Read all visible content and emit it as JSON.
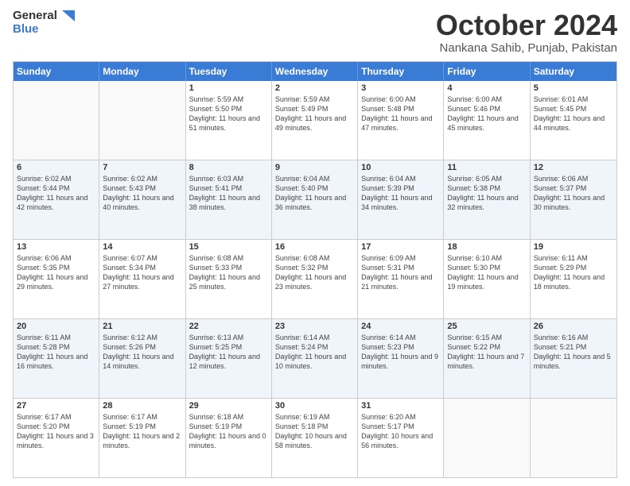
{
  "header": {
    "logo_general": "General",
    "logo_blue": "Blue",
    "month_title": "October 2024",
    "location": "Nankana Sahib, Punjab, Pakistan"
  },
  "calendar": {
    "days_of_week": [
      "Sunday",
      "Monday",
      "Tuesday",
      "Wednesday",
      "Thursday",
      "Friday",
      "Saturday"
    ],
    "rows": [
      [
        {
          "day": "",
          "empty": true
        },
        {
          "day": "",
          "empty": true
        },
        {
          "day": "1",
          "sunrise": "Sunrise: 5:59 AM",
          "sunset": "Sunset: 5:50 PM",
          "daylight": "Daylight: 11 hours and 51 minutes."
        },
        {
          "day": "2",
          "sunrise": "Sunrise: 5:59 AM",
          "sunset": "Sunset: 5:49 PM",
          "daylight": "Daylight: 11 hours and 49 minutes."
        },
        {
          "day": "3",
          "sunrise": "Sunrise: 6:00 AM",
          "sunset": "Sunset: 5:48 PM",
          "daylight": "Daylight: 11 hours and 47 minutes."
        },
        {
          "day": "4",
          "sunrise": "Sunrise: 6:00 AM",
          "sunset": "Sunset: 5:46 PM",
          "daylight": "Daylight: 11 hours and 45 minutes."
        },
        {
          "day": "5",
          "sunrise": "Sunrise: 6:01 AM",
          "sunset": "Sunset: 5:45 PM",
          "daylight": "Daylight: 11 hours and 44 minutes."
        }
      ],
      [
        {
          "day": "6",
          "sunrise": "Sunrise: 6:02 AM",
          "sunset": "Sunset: 5:44 PM",
          "daylight": "Daylight: 11 hours and 42 minutes."
        },
        {
          "day": "7",
          "sunrise": "Sunrise: 6:02 AM",
          "sunset": "Sunset: 5:43 PM",
          "daylight": "Daylight: 11 hours and 40 minutes."
        },
        {
          "day": "8",
          "sunrise": "Sunrise: 6:03 AM",
          "sunset": "Sunset: 5:41 PM",
          "daylight": "Daylight: 11 hours and 38 minutes."
        },
        {
          "day": "9",
          "sunrise": "Sunrise: 6:04 AM",
          "sunset": "Sunset: 5:40 PM",
          "daylight": "Daylight: 11 hours and 36 minutes."
        },
        {
          "day": "10",
          "sunrise": "Sunrise: 6:04 AM",
          "sunset": "Sunset: 5:39 PM",
          "daylight": "Daylight: 11 hours and 34 minutes."
        },
        {
          "day": "11",
          "sunrise": "Sunrise: 6:05 AM",
          "sunset": "Sunset: 5:38 PM",
          "daylight": "Daylight: 11 hours and 32 minutes."
        },
        {
          "day": "12",
          "sunrise": "Sunrise: 6:06 AM",
          "sunset": "Sunset: 5:37 PM",
          "daylight": "Daylight: 11 hours and 30 minutes."
        }
      ],
      [
        {
          "day": "13",
          "sunrise": "Sunrise: 6:06 AM",
          "sunset": "Sunset: 5:35 PM",
          "daylight": "Daylight: 11 hours and 29 minutes."
        },
        {
          "day": "14",
          "sunrise": "Sunrise: 6:07 AM",
          "sunset": "Sunset: 5:34 PM",
          "daylight": "Daylight: 11 hours and 27 minutes."
        },
        {
          "day": "15",
          "sunrise": "Sunrise: 6:08 AM",
          "sunset": "Sunset: 5:33 PM",
          "daylight": "Daylight: 11 hours and 25 minutes."
        },
        {
          "day": "16",
          "sunrise": "Sunrise: 6:08 AM",
          "sunset": "Sunset: 5:32 PM",
          "daylight": "Daylight: 11 hours and 23 minutes."
        },
        {
          "day": "17",
          "sunrise": "Sunrise: 6:09 AM",
          "sunset": "Sunset: 5:31 PM",
          "daylight": "Daylight: 11 hours and 21 minutes."
        },
        {
          "day": "18",
          "sunrise": "Sunrise: 6:10 AM",
          "sunset": "Sunset: 5:30 PM",
          "daylight": "Daylight: 11 hours and 19 minutes."
        },
        {
          "day": "19",
          "sunrise": "Sunrise: 6:11 AM",
          "sunset": "Sunset: 5:29 PM",
          "daylight": "Daylight: 11 hours and 18 minutes."
        }
      ],
      [
        {
          "day": "20",
          "sunrise": "Sunrise: 6:11 AM",
          "sunset": "Sunset: 5:28 PM",
          "daylight": "Daylight: 11 hours and 16 minutes."
        },
        {
          "day": "21",
          "sunrise": "Sunrise: 6:12 AM",
          "sunset": "Sunset: 5:26 PM",
          "daylight": "Daylight: 11 hours and 14 minutes."
        },
        {
          "day": "22",
          "sunrise": "Sunrise: 6:13 AM",
          "sunset": "Sunset: 5:25 PM",
          "daylight": "Daylight: 11 hours and 12 minutes."
        },
        {
          "day": "23",
          "sunrise": "Sunrise: 6:14 AM",
          "sunset": "Sunset: 5:24 PM",
          "daylight": "Daylight: 11 hours and 10 minutes."
        },
        {
          "day": "24",
          "sunrise": "Sunrise: 6:14 AM",
          "sunset": "Sunset: 5:23 PM",
          "daylight": "Daylight: 11 hours and 9 minutes."
        },
        {
          "day": "25",
          "sunrise": "Sunrise: 6:15 AM",
          "sunset": "Sunset: 5:22 PM",
          "daylight": "Daylight: 11 hours and 7 minutes."
        },
        {
          "day": "26",
          "sunrise": "Sunrise: 6:16 AM",
          "sunset": "Sunset: 5:21 PM",
          "daylight": "Daylight: 11 hours and 5 minutes."
        }
      ],
      [
        {
          "day": "27",
          "sunrise": "Sunrise: 6:17 AM",
          "sunset": "Sunset: 5:20 PM",
          "daylight": "Daylight: 11 hours and 3 minutes."
        },
        {
          "day": "28",
          "sunrise": "Sunrise: 6:17 AM",
          "sunset": "Sunset: 5:19 PM",
          "daylight": "Daylight: 11 hours and 2 minutes."
        },
        {
          "day": "29",
          "sunrise": "Sunrise: 6:18 AM",
          "sunset": "Sunset: 5:19 PM",
          "daylight": "Daylight: 11 hours and 0 minutes."
        },
        {
          "day": "30",
          "sunrise": "Sunrise: 6:19 AM",
          "sunset": "Sunset: 5:18 PM",
          "daylight": "Daylight: 10 hours and 58 minutes."
        },
        {
          "day": "31",
          "sunrise": "Sunrise: 6:20 AM",
          "sunset": "Sunset: 5:17 PM",
          "daylight": "Daylight: 10 hours and 56 minutes."
        },
        {
          "day": "",
          "empty": true
        },
        {
          "day": "",
          "empty": true
        }
      ]
    ]
  }
}
